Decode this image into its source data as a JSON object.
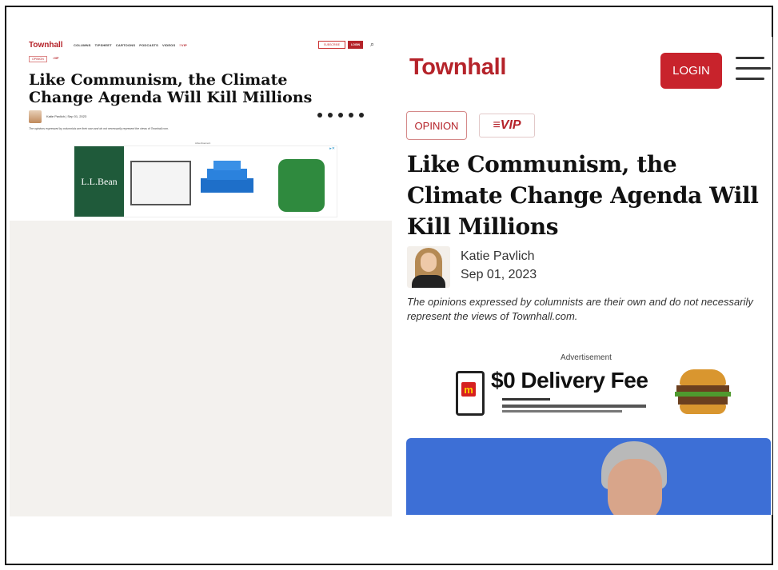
{
  "colors": {
    "brand_red": "#b5232a",
    "login_red": "#c8232c",
    "photo_blue": "#3d6fd6",
    "ad_green": "#1f5a3a"
  },
  "desktop": {
    "logo": "Townhall",
    "nav": [
      "COLUMNS",
      "TIPSHEET",
      "CARTOONS",
      "PODCASTS",
      "VIDEOS",
      "≡VIP"
    ],
    "subscribe": "SUBSCRIBE",
    "login": "LOGIN",
    "search_icon": "search-icon",
    "tags": [
      "OPINION",
      "≡VIP"
    ],
    "title": "Like Communism, the Climate Change Agenda Will Kill Millions",
    "byline": "Katie Pavlich | Sep 01, 2023",
    "share_icons": [
      "twitter-icon",
      "facebook-icon",
      "print-icon",
      "email-icon",
      "comment-icon"
    ],
    "disclaimer": "The opinions expressed by columnists are their own and do not necessarily represent the views of Townhall.com.",
    "ad_label": "Advertisement",
    "ad_brand": "L.L.Bean"
  },
  "mobile": {
    "logo": "Townhall",
    "login": "LOGIN",
    "menu_icon": "hamburger-menu-icon",
    "tag_opinion": "OPINION",
    "tag_vip": "≡VIP",
    "title": "Like Communism, the Climate Change Agenda Will Kill Millions",
    "author": "Katie Pavlich",
    "date": "Sep 01, 2023",
    "disclaimer": "The opinions expressed by columnists are their own and do not necessarily represent the views of Townhall.com.",
    "ad_label": "Advertisement",
    "ad_headline": "$0 Delivery Fee",
    "ad_logo": "m"
  }
}
